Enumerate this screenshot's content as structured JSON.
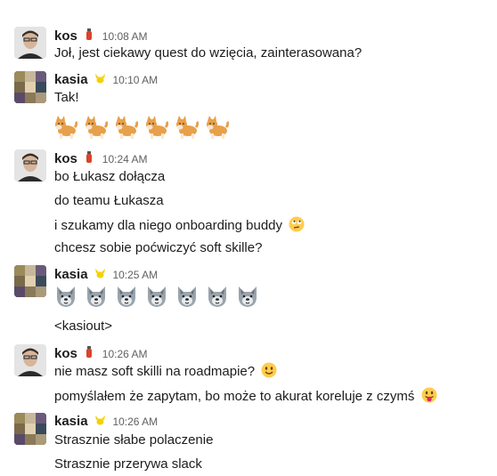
{
  "messages": [
    {
      "author": "kos",
      "time": "10:08 AM",
      "lines": [
        "Joł, jest ciekawy quest do wzięcia, zainterasowana?"
      ]
    },
    {
      "author": "kasia",
      "time": "10:10 AM",
      "lines": [
        "Tak!"
      ],
      "emoji_row": {
        "icon": "shiba-dog-icon",
        "count": 6
      }
    },
    {
      "author": "kos",
      "time": "10:24 AM",
      "lines": [
        "bo Łukasz dołącza",
        "do teamu Łukasza",
        "i szukamy dla niego onboarding buddy",
        "chcesz sobie poćwiczyć soft skille?"
      ],
      "line3_emoji": "eye-roll-face-icon"
    },
    {
      "author": "kasia",
      "time": "10:25 AM",
      "emoji_row": {
        "icon": "wolf-face-icon",
        "count": 7
      },
      "lines": [
        "<kasiout>"
      ]
    },
    {
      "author": "kos",
      "time": "10:26 AM",
      "lines": [
        "nie masz soft skilli na roadmapie?",
        "pomyślałem że zapytam, bo może to akurat koreluje z czymś"
      ],
      "line_emojis": [
        "slight-smile-icon",
        "tongue-face-icon"
      ]
    },
    {
      "author": "kasia",
      "time": "10:26 AM",
      "lines": [
        "Strasznie słabe polaczenie",
        "Strasznie przerywa slack"
      ]
    }
  ],
  "badges": {
    "kos": "fire-extinguisher-icon",
    "kasia": "pikachu-icon"
  },
  "colors": {
    "text": "#1d1c1d",
    "timestamp": "#616061",
    "background": "#ffffff"
  }
}
